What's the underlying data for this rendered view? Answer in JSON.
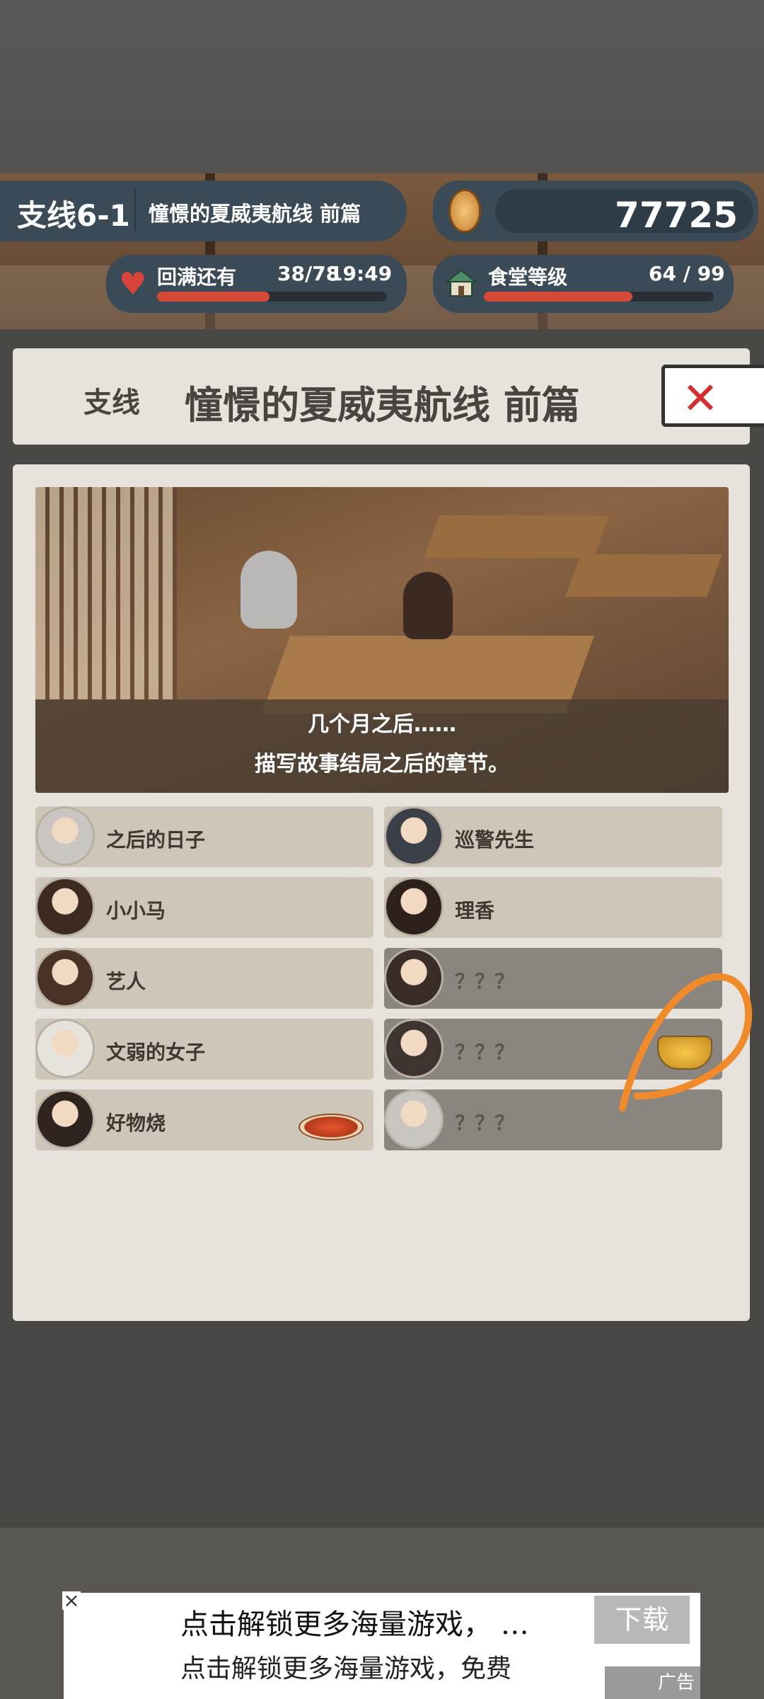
{
  "header": {
    "chapter_code": "支线6-1",
    "chapter_title": "憧憬的夏威夷航线 前篇",
    "coins": "77725",
    "stamina_label": "回满还有",
    "stamina_value": "38/78",
    "stamina_timer": "19:49",
    "stamina_progress": 0.49,
    "level_label": "食堂等级",
    "level_value": "64 / 99",
    "level_progress": 0.646
  },
  "title_panel": {
    "branch_label": "支线",
    "title": "憧憬的夏威夷航线 前篇"
  },
  "scene": {
    "caption_line1": "几个月之后……",
    "caption_line2": "描写故事结局之后的章节。"
  },
  "characters": [
    {
      "label": "之后的日子",
      "locked": false,
      "avatar_color": "#c9c6c2",
      "icon": ""
    },
    {
      "label": "巡警先生",
      "locked": false,
      "avatar_color": "#3b3f47",
      "icon": ""
    },
    {
      "label": "小小马",
      "locked": false,
      "avatar_color": "#3d2b22",
      "icon": ""
    },
    {
      "label": "理香",
      "locked": false,
      "avatar_color": "#2e211c",
      "icon": ""
    },
    {
      "label": "艺人",
      "locked": false,
      "avatar_color": "#4a3326",
      "icon": ""
    },
    {
      "label": "？？？",
      "locked": true,
      "avatar_color": "#3a2d27",
      "icon": ""
    },
    {
      "label": "文弱的女子",
      "locked": false,
      "avatar_color": "#e6e3dd",
      "icon": ""
    },
    {
      "label": "？？？",
      "locked": true,
      "avatar_color": "#3f3530",
      "icon": "gold-icon"
    },
    {
      "label": "好物烧",
      "locked": false,
      "avatar_color": "#2f241f",
      "icon": "dish-icon"
    },
    {
      "label": "？？？",
      "locked": true,
      "avatar_color": "#c9c6c2",
      "icon": ""
    }
  ],
  "ad": {
    "line1": "点击解锁更多海量游戏，  …",
    "line2": "点击解锁更多海量游戏，免费",
    "download_label": "下载",
    "ad_label": "广告",
    "close_symbol": "×"
  },
  "colors": {
    "pill_bg": "#3a4a57",
    "panel_bg": "#e7e2db",
    "progress_red": "#d44a36",
    "annotation_orange": "#f08a2a"
  }
}
